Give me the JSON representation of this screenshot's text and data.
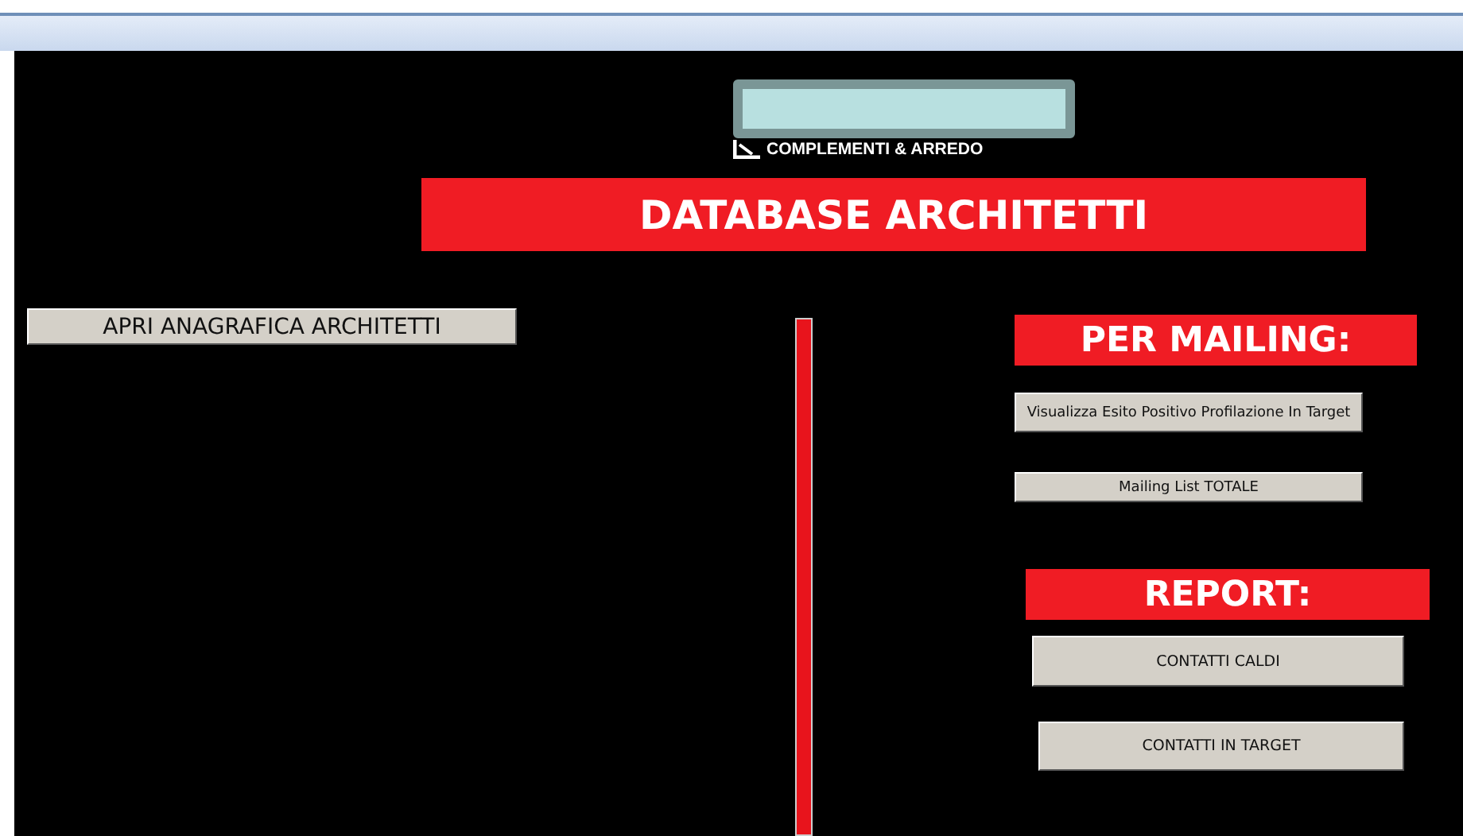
{
  "logo": {
    "text": "COMPLEMENTI & ARREDO"
  },
  "title": "DATABASE ARCHITETTI",
  "left_buttons": [
    "APRI ANAGRAFICA ARCHITETTI"
  ],
  "sections": [
    {
      "heading": "PER MAILING:",
      "buttons": [
        "Visualizza Esito Positivo Profilazione In Target",
        "Mailing List TOTALE"
      ]
    },
    {
      "heading": "REPORT:",
      "buttons": [
        "CONTATTI CALDI",
        "CONTATTI IN TARGET"
      ]
    }
  ]
}
